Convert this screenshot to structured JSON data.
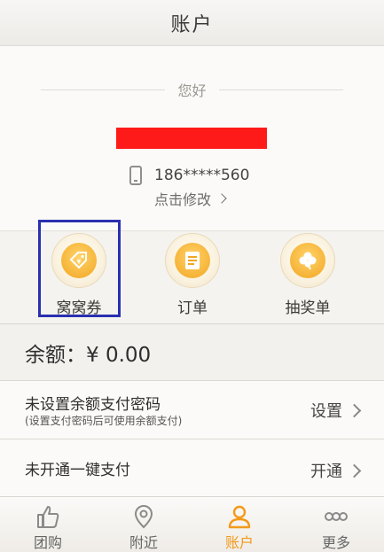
{
  "header": {
    "title": "账户"
  },
  "profile": {
    "greeting": "您好",
    "phone": "186*****560",
    "edit_label": "点击修改"
  },
  "shortcuts": [
    {
      "label": "窝窝券",
      "icon": "ticket-icon"
    },
    {
      "label": "订单",
      "icon": "order-icon"
    },
    {
      "label": "抽奖单",
      "icon": "clover-icon"
    }
  ],
  "balance": {
    "label": "余额：¥ 0.00"
  },
  "rows": [
    {
      "title": "未设置余额支付密码",
      "subtitle": "(设置支付密码后可使用余额支付)",
      "action": "设置"
    },
    {
      "title": "未开通一键支付",
      "action": "开通"
    }
  ],
  "tabs": [
    {
      "label": "团购",
      "icon": "thumbs-up-icon"
    },
    {
      "label": "附近",
      "icon": "location-pin-icon"
    },
    {
      "label": "账户",
      "icon": "user-icon",
      "active": true
    },
    {
      "label": "更多",
      "icon": "more-icon"
    }
  ],
  "colors": {
    "accent": "#f39a1a",
    "highlight_box": "#2b2fb0",
    "redaction": "#ff1a1a"
  }
}
